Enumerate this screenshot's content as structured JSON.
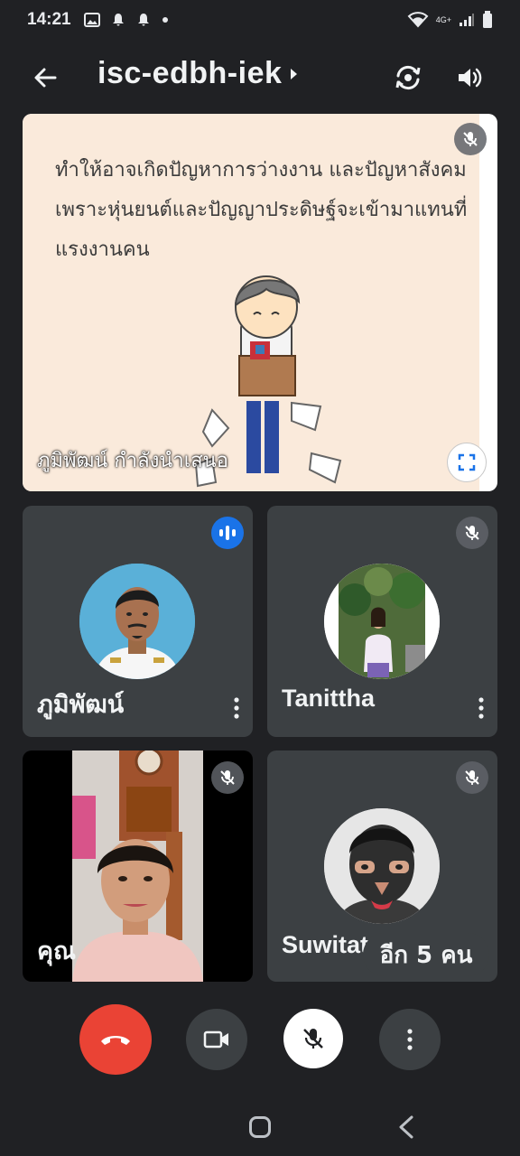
{
  "status_bar": {
    "time": "14:21",
    "network_label": "4G+"
  },
  "header": {
    "meeting_code": "isc-edbh-iek"
  },
  "presentation": {
    "slide_lines": [
      "ทำให้อาจเกิดปัญหาการว่างงาน และปัญหาสังคม",
      "เพราะหุ่นยนต์และปัญญาประดิษฐ์จะเข้ามาแทนที่",
      "แรงงานคน"
    ],
    "presenter_label": "ภูมิพัฒน์ กำลังนำเสนอ"
  },
  "participants": [
    {
      "name": "ภูมิพัฒน์",
      "state": "speaking"
    },
    {
      "name": "Tanittha",
      "state": "muted"
    },
    {
      "name": "คุณ",
      "state": "muted"
    },
    {
      "name": "Suwitat",
      "state": "muted"
    }
  ],
  "more_participants_label": "อีก 5 คน",
  "colors": {
    "end_call": "#ea4335",
    "speaking_blue": "#1a73e8",
    "background": "#202124",
    "tile": "#3c4043"
  },
  "icons": {
    "back": "arrow-left-icon",
    "switch_camera": "switch-camera-icon",
    "speaker": "speaker-icon",
    "mic_off": "mic-off-icon",
    "fullscreen": "fullscreen-icon",
    "end_call": "phone-hangup-icon",
    "camera": "video-camera-icon",
    "more": "more-vert-icon"
  }
}
